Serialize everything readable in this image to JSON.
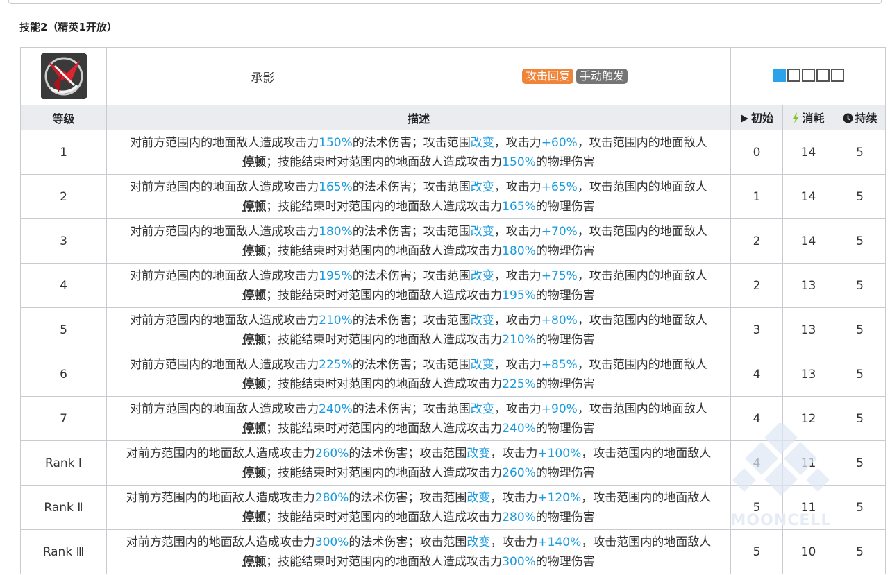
{
  "section_title": "技能2（精英1开放）",
  "skill": {
    "icon": "skill-icon",
    "name": "承影",
    "tags": [
      {
        "label": "攻击回复",
        "color": "#f08439"
      },
      {
        "label": "手动触发",
        "color": "#757575"
      }
    ],
    "level_squares_filled": 1,
    "level_squares_total": 5
  },
  "headers": {
    "level": "等级",
    "desc": "描述",
    "initial": "初始",
    "cost": "消耗",
    "duration": "持续"
  },
  "desc_parts": {
    "p1": "对前方范围内的地面敌人造成攻击力",
    "p2": "的法术伤害；攻击范围",
    "change": "改变",
    "p3": "，攻击力",
    "p4": "，攻击范围内的地面敌人",
    "stun": "停顿",
    "p5": "；技能结束时对范围内的地面敌人造成攻击力",
    "p6": "的物理伤害"
  },
  "rows": [
    {
      "level": "1",
      "pct": "150%",
      "atk": "+60%",
      "initial": "0",
      "cost": "14",
      "duration": "5"
    },
    {
      "level": "2",
      "pct": "165%",
      "atk": "+65%",
      "initial": "1",
      "cost": "14",
      "duration": "5"
    },
    {
      "level": "3",
      "pct": "180%",
      "atk": "+70%",
      "initial": "2",
      "cost": "14",
      "duration": "5"
    },
    {
      "level": "4",
      "pct": "195%",
      "atk": "+75%",
      "initial": "2",
      "cost": "13",
      "duration": "5"
    },
    {
      "level": "5",
      "pct": "210%",
      "atk": "+80%",
      "initial": "3",
      "cost": "13",
      "duration": "5"
    },
    {
      "level": "6",
      "pct": "225%",
      "atk": "+85%",
      "initial": "4",
      "cost": "13",
      "duration": "5"
    },
    {
      "level": "7",
      "pct": "240%",
      "atk": "+90%",
      "initial": "4",
      "cost": "12",
      "duration": "5"
    },
    {
      "level": "Rank Ⅰ",
      "pct": "260%",
      "atk": "+100%",
      "initial": "4",
      "cost": "11",
      "duration": "5"
    },
    {
      "level": "Rank Ⅱ",
      "pct": "280%",
      "atk": "+120%",
      "initial": "5",
      "cost": "11",
      "duration": "5"
    },
    {
      "level": "Rank Ⅲ",
      "pct": "300%",
      "atk": "+140%",
      "initial": "5",
      "cost": "10",
      "duration": "5"
    }
  ],
  "watermark": "MOONCELL"
}
